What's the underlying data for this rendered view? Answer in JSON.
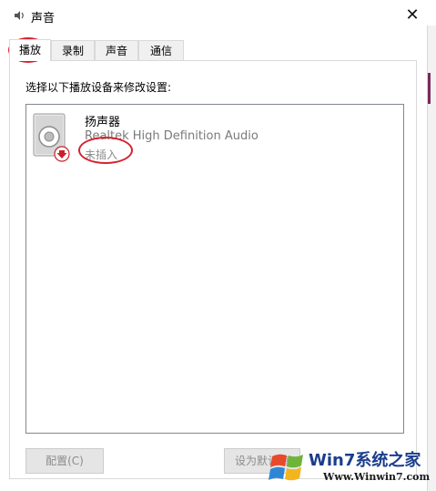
{
  "window": {
    "title": "声音",
    "close_glyph": "✕"
  },
  "tabs": [
    {
      "label": "播放",
      "active": true
    },
    {
      "label": "录制",
      "active": false
    },
    {
      "label": "声音",
      "active": false
    },
    {
      "label": "通信",
      "active": false
    }
  ],
  "panel": {
    "instructions": "选择以下播放设备来修改设置:"
  },
  "devices": [
    {
      "name": "扬声器",
      "description": "Realtek High Definition Audio",
      "status": "未插入",
      "icon": "speaker-icon",
      "status_icon": "unplugged-arrow-icon"
    }
  ],
  "buttons": {
    "configure": "配置(C)",
    "set_default": "设为默认值"
  },
  "watermark": {
    "brand": "Win7系统之家",
    "url": "Www.Winwin7.com"
  },
  "colors": {
    "highlight_oval": "#d8212f",
    "status_arrow": "#cc1f2a",
    "watermark_blue": "#1a3e8c"
  }
}
